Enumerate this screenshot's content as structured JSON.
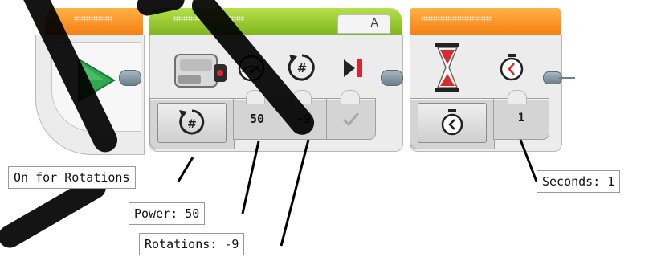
{
  "program": {
    "motor_block": {
      "port": "A",
      "mode_icon": "rotations-hash-icon",
      "icons": [
        "large-motor-icon",
        "power-gauge-icon",
        "rotations-hash-icon",
        "brake-stop-icon"
      ],
      "power_value": "50",
      "rotations_value": "-9",
      "brake_icon": "checkmark-icon"
    },
    "wait_block": {
      "icon": "hourglass-icon",
      "mode_icon": "stopwatch-icon",
      "param_icon": "timer-icon",
      "seconds_value": "1"
    },
    "start_block": {
      "icon": "play-icon"
    }
  },
  "callouts": {
    "mode": "On for Rotations",
    "power": "Power: 50",
    "rotations": "Rotations: -9",
    "seconds": "Seconds: 1"
  },
  "colors": {
    "start_header": "#f5921e",
    "motor_header": "#8cc12c",
    "wait_header": "#f5921e",
    "play": "#2fa84f",
    "hourglass_red": "#d82b2b",
    "brake_red": "#e0242c"
  }
}
